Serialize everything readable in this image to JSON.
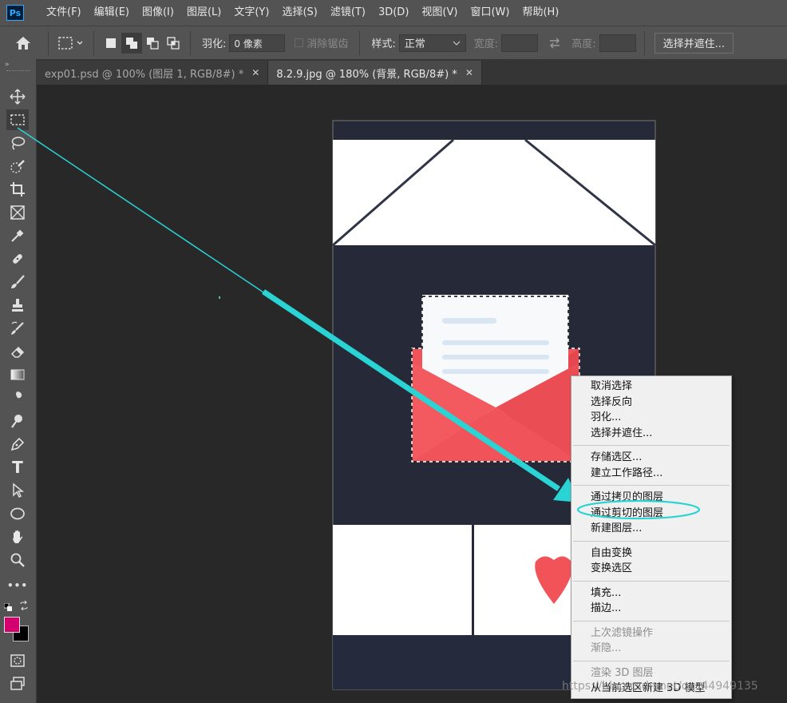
{
  "app": {
    "logo": "Ps"
  },
  "menubar": {
    "items": [
      "文件(F)",
      "编辑(E)",
      "图像(I)",
      "图层(L)",
      "文字(Y)",
      "选择(S)",
      "滤镜(T)",
      "3D(D)",
      "视图(V)",
      "窗口(W)",
      "帮助(H)"
    ]
  },
  "options": {
    "feather_label": "羽化:",
    "feather_value": "0 像素",
    "antialias_label": "消除锯齿",
    "style_label": "样式:",
    "style_value": "正常",
    "width_label": "宽度:",
    "height_label": "高度:",
    "select_mask_button": "选择并遮住..."
  },
  "tabs": [
    {
      "label": "exp01.psd @ 100% (图层 1, RGB/8#) *",
      "close": "✕",
      "active": false
    },
    {
      "label": "8.2.9.jpg @ 180% (背景, RGB/8#) *",
      "close": "✕",
      "active": true
    }
  ],
  "toolbar": {
    "icons": [
      "move-icon",
      "marquee-icon",
      "lasso-icon",
      "quick-select-icon",
      "crop-icon",
      "frame-icon",
      "eyedropper-icon",
      "healing-icon",
      "brush-icon",
      "stamp-icon",
      "history-brush-icon",
      "eraser-icon",
      "gradient-icon",
      "smudge-icon",
      "dodge-icon",
      "pen-icon",
      "type-icon",
      "path-select-icon",
      "ellipse-icon",
      "hand-icon",
      "zoom-icon",
      "more-icon"
    ],
    "type_glyph": "T",
    "more_glyph": "•••",
    "foreground_color": "#d4006e",
    "background_color": "#000000"
  },
  "context_menu": {
    "groups": [
      [
        "取消选择",
        "选择反向",
        "羽化...",
        "选择并遮住..."
      ],
      [
        "存储选区...",
        "建立工作路径..."
      ],
      [
        "通过拷贝的图层",
        "通过剪切的图层",
        "新建图层..."
      ],
      [
        "自由变换",
        "变换选区"
      ],
      [
        "填充...",
        "描边..."
      ],
      [
        "上次滤镜操作",
        "渐隐..."
      ],
      [
        "渲染 3D 图层",
        "从当前选区新建 3D 模型"
      ]
    ],
    "disabled": [
      "上次滤镜操作",
      "渐隐...",
      "渲染 3D 图层"
    ],
    "highlighted_item": "通过剪切的图层"
  },
  "annotation": {
    "arrow_color": "#2ad4d4"
  },
  "watermark": "https://blog.csdn.net/qq_44949135"
}
